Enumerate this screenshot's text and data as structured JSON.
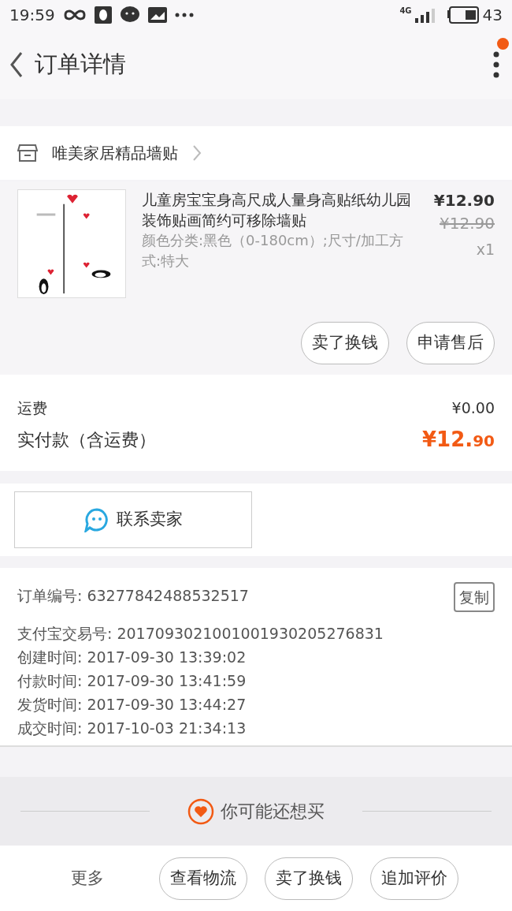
{
  "status_bar": {
    "time": "19:59",
    "network": "4G",
    "battery": "43"
  },
  "header": {
    "title": "订单详情",
    "has_notification": true
  },
  "shop": {
    "name": "唯美家居精品墙贴"
  },
  "item": {
    "title": "儿童房宝宝身高尺成人量身高贴纸幼儿园装饰贴画简约可移除墙贴",
    "spec": "颜色分类:黑色（0-180cm）;尺寸/加工方式:特大",
    "price": "¥12.90",
    "original_price": "¥12.90",
    "quantity": "x1",
    "actions": [
      "卖了换钱",
      "申请售后"
    ]
  },
  "fees": [
    {
      "label": "运费",
      "value": "¥0.00",
      "kind": "plain"
    },
    {
      "label": "实付款（含运费）",
      "value_main": "¥12.",
      "value_fraction": "90",
      "kind": "total"
    }
  ],
  "contact_button": "联系卖家",
  "order_info": {
    "copy_button": "复制",
    "rows": [
      "订单编号: 63277842488532517",
      "支付宝交易号: 2017093021001001930205276831",
      "创建时间: 2017-09-30 13:39:02",
      "付款时间: 2017-09-30 13:41:59",
      "发货时间: 2017-09-30 13:44:27",
      "成交时间: 2017-10-03 21:34:13"
    ]
  },
  "recommend": {
    "title": "你可能还想买"
  },
  "bottom_bar": {
    "more": "更多",
    "buttons": [
      "查看物流",
      "卖了换钱",
      "追加评价"
    ]
  }
}
